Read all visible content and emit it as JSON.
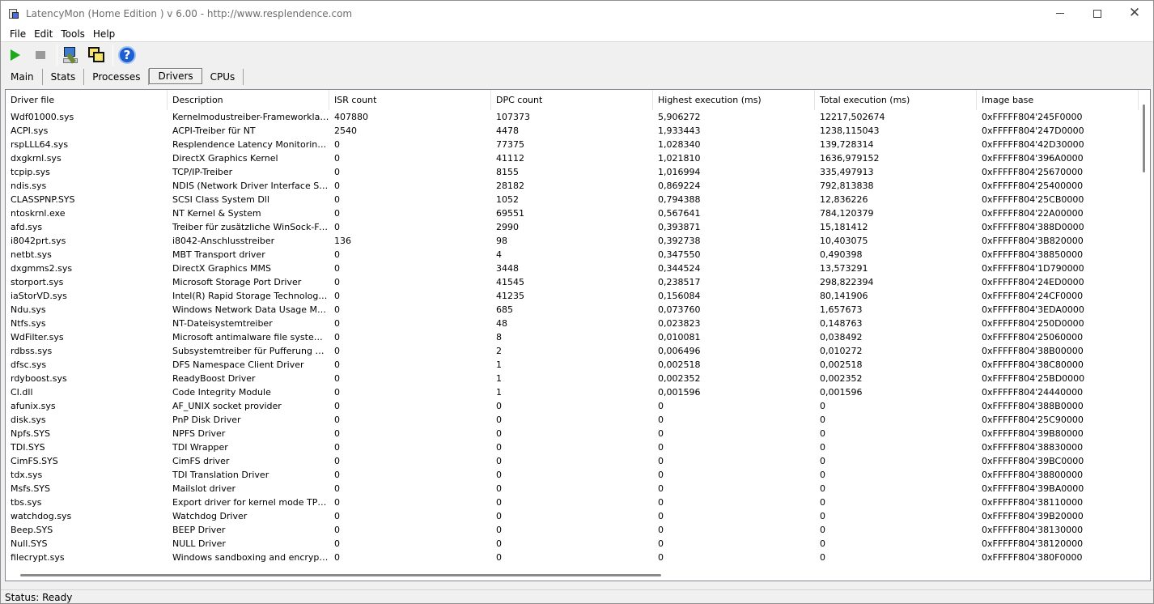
{
  "window": {
    "title": "LatencyMon  (Home Edition )  v 6.00 - http://www.resplendence.com"
  },
  "menu": [
    "File",
    "Edit",
    "Tools",
    "Help"
  ],
  "toolbar": {
    "icons": [
      "play-icon",
      "stop-icon",
      "tools-icon",
      "windows-icon",
      "help-icon"
    ]
  },
  "tabs": [
    "Main",
    "Stats",
    "Processes",
    "Drivers",
    "CPUs"
  ],
  "active_tab": "Drivers",
  "table": {
    "columns": [
      "Driver file",
      "Description",
      "ISR count",
      "DPC count",
      "Highest execution (ms)",
      "Total execution (ms)",
      "Image base"
    ],
    "rows": [
      [
        "Wdf01000.sys",
        "Kernelmodustreiber-Frameworklaufzeit",
        "407880",
        "107373",
        "5,906272",
        "12217,502674",
        "0xFFFFF804'245F0000"
      ],
      [
        "ACPI.sys",
        "ACPI-Treiber für NT",
        "2540",
        "4478",
        "1,933443",
        "1238,115043",
        "0xFFFFF804'247D0000"
      ],
      [
        "rspLLL64.sys",
        "Resplendence Latency Monitoring a...",
        "0",
        "77375",
        "1,028340",
        "139,728314",
        "0xFFFFF804'42D30000"
      ],
      [
        "dxgkrnl.sys",
        "DirectX Graphics Kernel",
        "0",
        "41112",
        "1,021810",
        "1636,979152",
        "0xFFFFF804'396A0000"
      ],
      [
        "tcpip.sys",
        "TCP/IP-Treiber",
        "0",
        "8155",
        "1,016994",
        "335,497913",
        "0xFFFFF804'25670000"
      ],
      [
        "ndis.sys",
        "NDIS (Network Driver Interface Spe...",
        "0",
        "28182",
        "0,869224",
        "792,813838",
        "0xFFFFF804'25400000"
      ],
      [
        "CLASSPNP.SYS",
        "SCSI Class System Dll",
        "0",
        "1052",
        "0,794388",
        "12,836226",
        "0xFFFFF804'25CB0000"
      ],
      [
        "ntoskrnl.exe",
        "NT Kernel & System",
        "0",
        "69551",
        "0,567641",
        "784,120379",
        "0xFFFFF804'22A00000"
      ],
      [
        "afd.sys",
        "Treiber für zusätzliche WinSock-Fun...",
        "0",
        "2990",
        "0,393871",
        "15,181412",
        "0xFFFFF804'388D0000"
      ],
      [
        "i8042prt.sys",
        "i8042-Anschlusstreiber",
        "136",
        "98",
        "0,392738",
        "10,403075",
        "0xFFFFF804'3B820000"
      ],
      [
        "netbt.sys",
        "MBT Transport driver",
        "0",
        "4",
        "0,347550",
        "0,490398",
        "0xFFFFF804'38850000"
      ],
      [
        "dxgmms2.sys",
        "DirectX Graphics MMS",
        "0",
        "3448",
        "0,344524",
        "13,573291",
        "0xFFFFF804'1D790000"
      ],
      [
        "storport.sys",
        "Microsoft Storage Port Driver",
        "0",
        "41545",
        "0,238517",
        "298,822394",
        "0xFFFFF804'24ED0000"
      ],
      [
        "iaStorVD.sys",
        "Intel(R) Rapid Storage Technology ...",
        "0",
        "41235",
        "0,156084",
        "80,141906",
        "0xFFFFF804'24CF0000"
      ],
      [
        "Ndu.sys",
        "Windows Network Data Usage Monit...",
        "0",
        "685",
        "0,073760",
        "1,657673",
        "0xFFFFF804'3EDA0000"
      ],
      [
        "Ntfs.sys",
        "NT-Dateisystemtreiber",
        "0",
        "48",
        "0,023823",
        "0,148763",
        "0xFFFFF804'250D0000"
      ],
      [
        "WdFilter.sys",
        "Microsoft antimalware file system filt...",
        "0",
        "8",
        "0,010081",
        "0,038492",
        "0xFFFFF804'25060000"
      ],
      [
        "rdbss.sys",
        "Subsystemtreiber für Pufferung des...",
        "0",
        "2",
        "0,006496",
        "0,010272",
        "0xFFFFF804'38B00000"
      ],
      [
        "dfsc.sys",
        "DFS Namespace Client Driver",
        "0",
        "1",
        "0,002518",
        "0,002518",
        "0xFFFFF804'38C80000"
      ],
      [
        "rdyboost.sys",
        "ReadyBoost Driver",
        "0",
        "1",
        "0,002352",
        "0,002352",
        "0xFFFFF804'25BD0000"
      ],
      [
        "CI.dll",
        "Code Integrity Module",
        "0",
        "1",
        "0,001596",
        "0,001596",
        "0xFFFFF804'24440000"
      ],
      [
        "afunix.sys",
        "AF_UNIX socket provider",
        "0",
        "0",
        "0",
        "0",
        "0xFFFFF804'388B0000"
      ],
      [
        "disk.sys",
        "PnP Disk Driver",
        "0",
        "0",
        "0",
        "0",
        "0xFFFFF804'25C90000"
      ],
      [
        "Npfs.SYS",
        "NPFS Driver",
        "0",
        "0",
        "0",
        "0",
        "0xFFFFF804'39B80000"
      ],
      [
        "TDI.SYS",
        "TDI Wrapper",
        "0",
        "0",
        "0",
        "0",
        "0xFFFFF804'38830000"
      ],
      [
        "CimFS.SYS",
        "CimFS driver",
        "0",
        "0",
        "0",
        "0",
        "0xFFFFF804'39BC0000"
      ],
      [
        "tdx.sys",
        "TDI Translation Driver",
        "0",
        "0",
        "0",
        "0",
        "0xFFFFF804'38800000"
      ],
      [
        "Msfs.SYS",
        "Mailslot driver",
        "0",
        "0",
        "0",
        "0",
        "0xFFFFF804'39BA0000"
      ],
      [
        "tbs.sys",
        "Export driver for kernel mode TPM API",
        "0",
        "0",
        "0",
        "0",
        "0xFFFFF804'38110000"
      ],
      [
        "watchdog.sys",
        "Watchdog Driver",
        "0",
        "0",
        "0",
        "0",
        "0xFFFFF804'39B20000"
      ],
      [
        "Beep.SYS",
        "BEEP Driver",
        "0",
        "0",
        "0",
        "0",
        "0xFFFFF804'38130000"
      ],
      [
        "Null.SYS",
        "NULL Driver",
        "0",
        "0",
        "0",
        "0",
        "0xFFFFF804'38120000"
      ],
      [
        "filecrypt.sys",
        "Windows sandboxing and encryptio...",
        "0",
        "0",
        "0",
        "0",
        "0xFFFFF804'380F0000"
      ]
    ]
  },
  "status": {
    "text": "Status: Ready"
  }
}
